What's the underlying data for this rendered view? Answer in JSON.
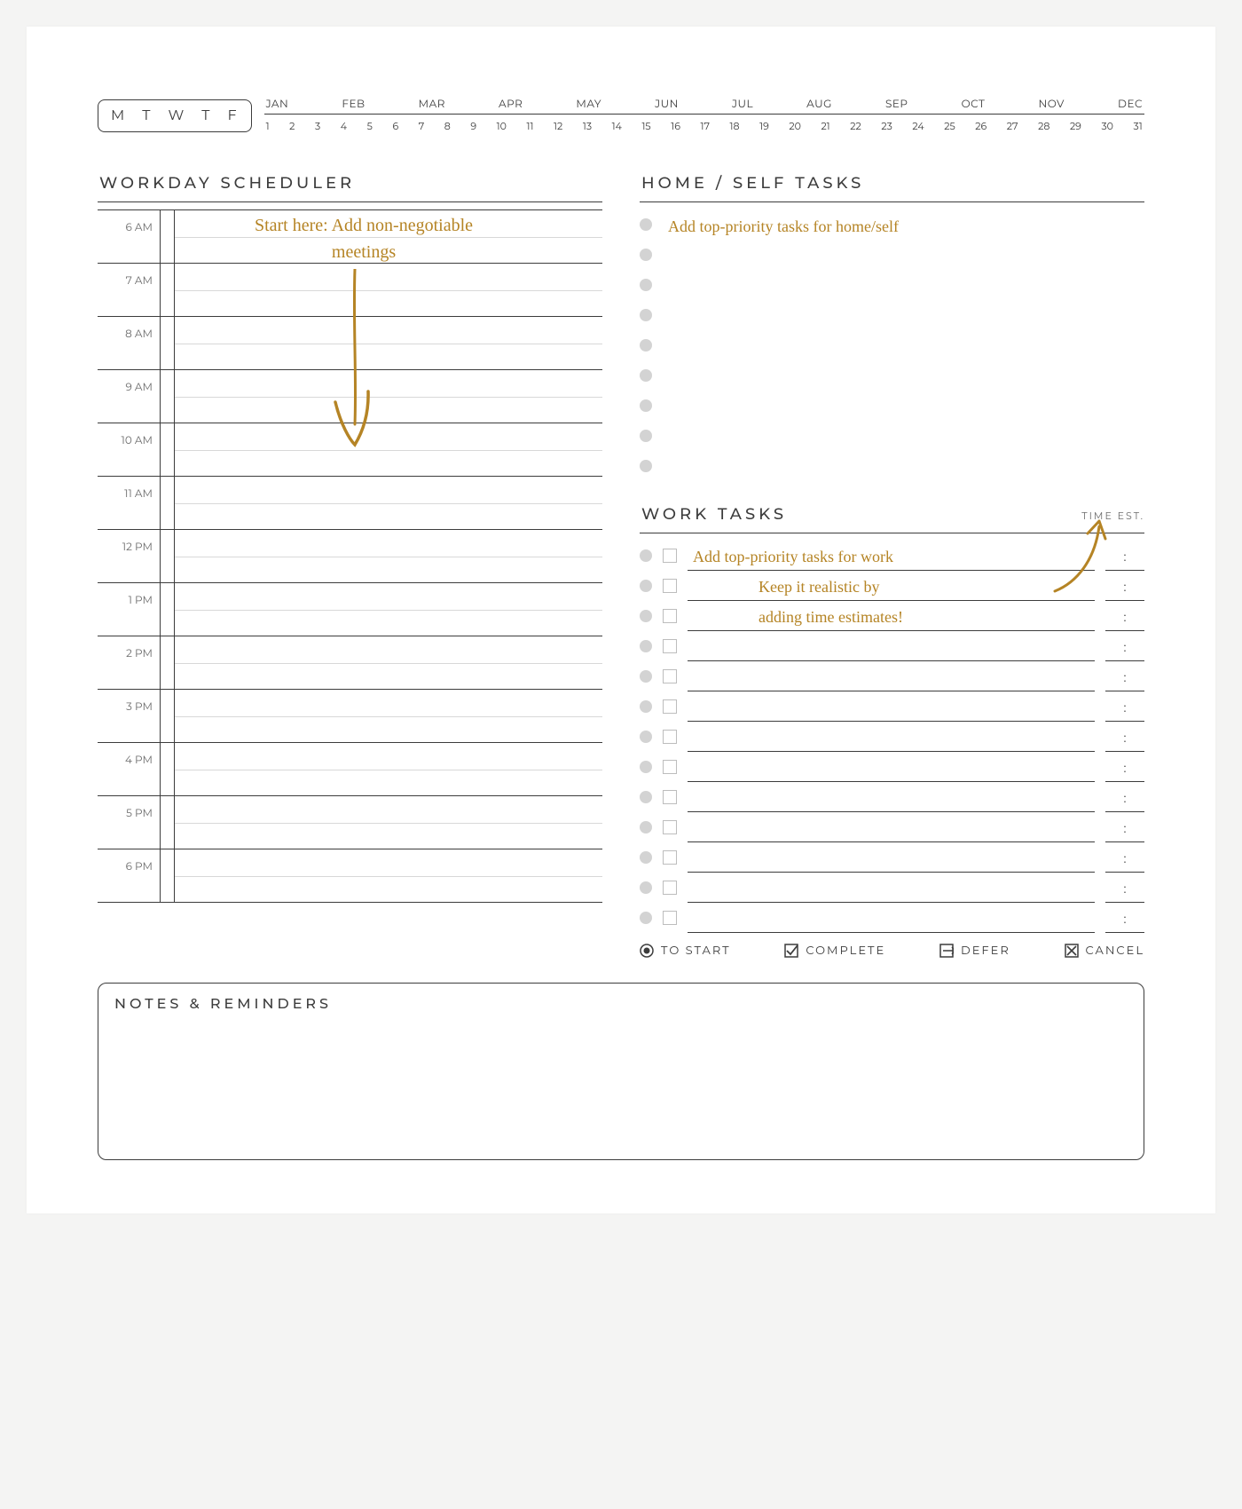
{
  "colors": {
    "accent": "#b58425"
  },
  "weekday_labels": [
    "M",
    "T",
    "W",
    "T",
    "F"
  ],
  "months": [
    "JAN",
    "FEB",
    "MAR",
    "APR",
    "MAY",
    "JUN",
    "JUL",
    "AUG",
    "SEP",
    "OCT",
    "NOV",
    "DEC"
  ],
  "days": [
    "1",
    "2",
    "3",
    "4",
    "5",
    "6",
    "7",
    "8",
    "9",
    "10",
    "11",
    "12",
    "13",
    "14",
    "15",
    "16",
    "17",
    "18",
    "19",
    "20",
    "21",
    "22",
    "23",
    "24",
    "25",
    "26",
    "27",
    "28",
    "29",
    "30",
    "31"
  ],
  "sections": {
    "scheduler_title": "WORKDAY SCHEDULER",
    "home_title": "HOME / SELF TASKS",
    "work_title": "WORK TASKS",
    "time_est_label": "TIME EST.",
    "notes_title": "NOTES & REMINDERS"
  },
  "hours": [
    "6 AM",
    "7 AM",
    "8 AM",
    "9 AM",
    "10 AM",
    "11 AM",
    "12 PM",
    "1 PM",
    "2 PM",
    "3 PM",
    "4 PM",
    "5 PM",
    "6 PM"
  ],
  "annotations": {
    "scheduler_hint_l1": "Start here: Add non-negotiable",
    "scheduler_hint_l2": "meetings",
    "home_hint": "Add top-priority tasks for home/self",
    "work_hint_l1": "Add top-priority tasks for work",
    "work_hint_l2": "Keep it realistic by",
    "work_hint_l3": "adding time estimates!"
  },
  "home_rows": 9,
  "work_rows": 13,
  "legend": {
    "to_start": "TO START",
    "complete": "COMPLETE",
    "defer": "DEFER",
    "cancel": "CANCEL"
  }
}
